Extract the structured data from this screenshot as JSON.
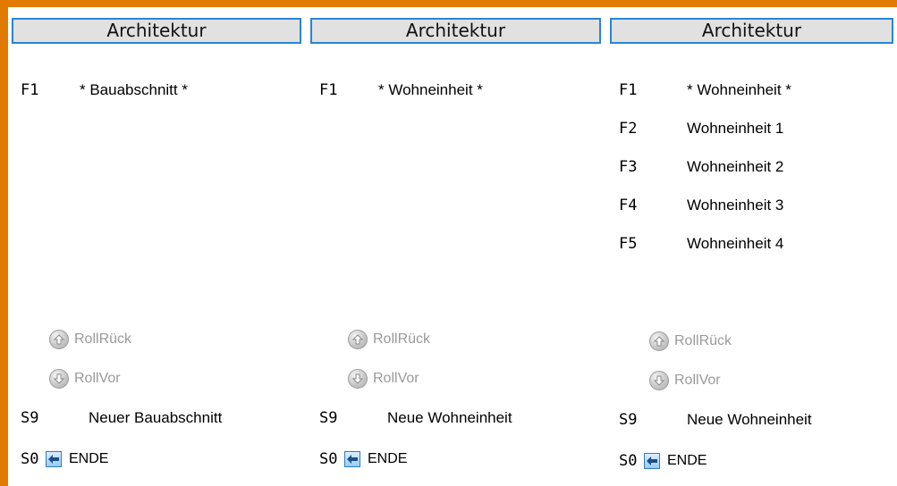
{
  "colors": {
    "frame": "#E07B00",
    "header_border": "#2A84D4",
    "header_bg": "#E1E1E1",
    "disabled_text": "#9A9A9A"
  },
  "panels": [
    {
      "header": "Architektur",
      "items": [
        {
          "key": "F1",
          "label": "* Bauabschnitt *"
        }
      ],
      "scroll_up": {
        "icon": "arrow-up-circle-icon",
        "label": "RollRück"
      },
      "scroll_down": {
        "icon": "arrow-down-circle-icon",
        "label": "RollVor"
      },
      "s9": {
        "key": "S9",
        "label": "Neuer Bauabschnitt"
      },
      "s0": {
        "key": "S0",
        "icon": "back-arrow-icon",
        "label": "ENDE"
      }
    },
    {
      "header": "Architektur",
      "items": [
        {
          "key": "F1",
          "label": "* Wohneinheit *"
        }
      ],
      "scroll_up": {
        "icon": "arrow-up-circle-icon",
        "label": "RollRück"
      },
      "scroll_down": {
        "icon": "arrow-down-circle-icon",
        "label": "RollVor"
      },
      "s9": {
        "key": "S9",
        "label": "Neue Wohneinheit"
      },
      "s0": {
        "key": "S0",
        "icon": "back-arrow-icon",
        "label": "ENDE"
      }
    },
    {
      "header": "Architektur",
      "items": [
        {
          "key": "F1",
          "label": "* Wohneinheit *"
        },
        {
          "key": "F2",
          "label": "Wohneinheit 1"
        },
        {
          "key": "F3",
          "label": "Wohneinheit 2"
        },
        {
          "key": "F4",
          "label": "Wohneinheit 3"
        },
        {
          "key": "F5",
          "label": "Wohneinheit 4"
        }
      ],
      "scroll_up": {
        "icon": "arrow-up-circle-icon",
        "label": "RollRück"
      },
      "scroll_down": {
        "icon": "arrow-down-circle-icon",
        "label": "RollVor"
      },
      "s9": {
        "key": "S9",
        "label": "Neue Wohneinheit"
      },
      "s0": {
        "key": "S0",
        "icon": "back-arrow-icon",
        "label": "ENDE"
      }
    }
  ]
}
